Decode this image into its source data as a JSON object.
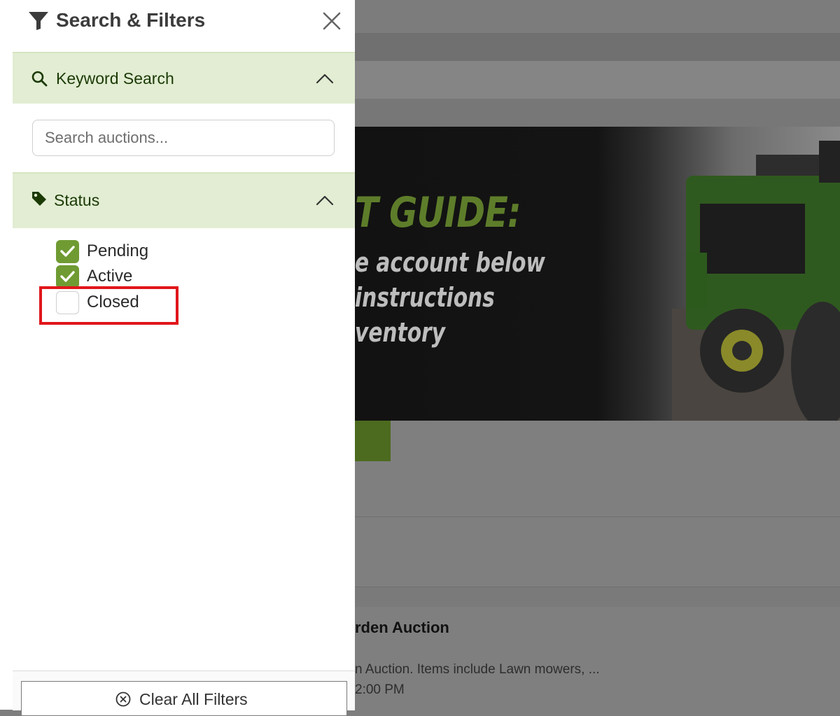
{
  "panel": {
    "title": "Search & Filters",
    "close_icon": "close-icon",
    "filter_icon": "filter-icon"
  },
  "keyword_section": {
    "label": "Keyword Search",
    "icon": "search-icon",
    "expanded": true,
    "search_placeholder": "Search auctions...",
    "search_value": ""
  },
  "status_section": {
    "label": "Status",
    "icon": "tag-icon",
    "expanded": true,
    "options": [
      {
        "label": "Pending",
        "checked": true
      },
      {
        "label": "Active",
        "checked": true
      },
      {
        "label": "Closed",
        "checked": false
      }
    ]
  },
  "footer": {
    "clear_label": "Clear All Filters",
    "clear_icon": "circle-x-icon"
  },
  "background": {
    "band_text": "...",
    "banner": {
      "heading": "T GUIDE:",
      "lines": [
        "e account below",
        "instructions",
        "ventory"
      ]
    },
    "listing_title": "rden Auction",
    "listing_desc": "n Auction. Items include Lawn mowers, ...",
    "listing_time": "2:00 PM"
  },
  "colors": {
    "accent_green": "#6f9b32",
    "section_bg": "#e2edd3",
    "highlight_red": "#e0161b"
  }
}
